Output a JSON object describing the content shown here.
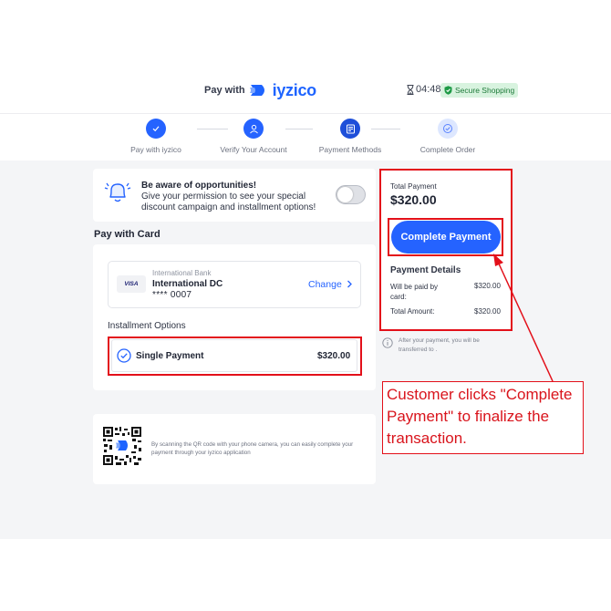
{
  "header": {
    "pay_with": "Pay with",
    "logo_text": "iyzico",
    "timer": "04:48",
    "secure_label": "Secure Shopping"
  },
  "steps": [
    {
      "label": "Pay with iyzico",
      "state": "done",
      "icon": "check-icon"
    },
    {
      "label": "Verify Your Account",
      "state": "current",
      "icon": "user-icon"
    },
    {
      "label": "Payment Methods",
      "state": "current",
      "icon": "payment-icon"
    },
    {
      "label": "Complete Order",
      "state": "pending",
      "icon": "check-circle-icon"
    }
  ],
  "opportunities": {
    "title": "Be aware of opportunities!",
    "description": "Give your permission to see your special discount campaign and installment options!",
    "toggle_on": false
  },
  "pay_with_card": {
    "title": "Pay with Card",
    "card_brand": "VISA",
    "bank_name": "International Bank",
    "card_name": "International DC",
    "card_number": "**** 0007",
    "change_label": "Change"
  },
  "installments": {
    "title": "Installment Options",
    "option_label": "Single Payment",
    "option_amount": "$320.00",
    "selected": true
  },
  "qr": {
    "text": "By scanning the QR code with your phone camera, you can easily complete your payment through your iyzico application"
  },
  "summary": {
    "total_label": "Total Payment",
    "total_amount": "$320.00",
    "complete_button": "Complete Payment",
    "details_title": "Payment Details",
    "paid_by_card_label": "Will be paid by card:",
    "paid_by_card_amount": "$320.00",
    "total_amount_label": "Total Amount:",
    "total_amount_value": "$320.00",
    "info_text": "After your payment, you will be transferred to ."
  },
  "annotation": {
    "text": "Customer clicks \"Complete Payment\" to finalize the transaction."
  },
  "colors": {
    "primary": "#2563ff",
    "annotation_red": "#e3101a",
    "secure_bg": "#d8f3df",
    "secure_text": "#1d7a39",
    "band_bg": "#f4f5f7"
  }
}
